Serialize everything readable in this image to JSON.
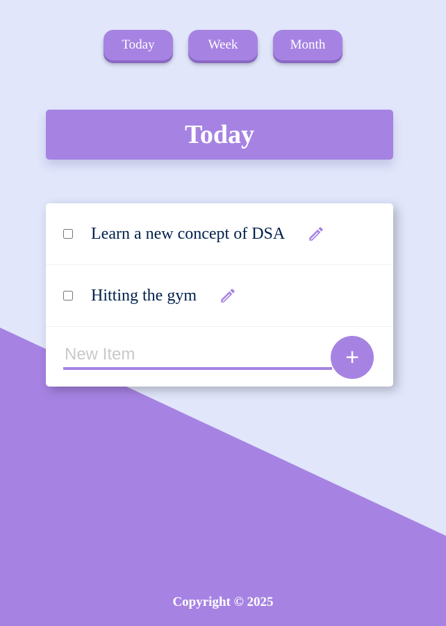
{
  "nav": {
    "buttons": [
      {
        "label": "Today"
      },
      {
        "label": "Week"
      },
      {
        "label": "Month"
      }
    ]
  },
  "list": {
    "title": "Today",
    "items": [
      {
        "text": "Learn a new concept of DSA",
        "checked": false
      },
      {
        "text": "Hitting the gym",
        "checked": false
      }
    ],
    "new_item_placeholder": "New Item",
    "new_item_value": "",
    "add_button_label": "+"
  },
  "footer": {
    "text": "Copyright © 2025"
  },
  "colors": {
    "accent": "#a683e3",
    "background": "#e1e6fb",
    "item_text": "#00204a"
  },
  "icons": {
    "edit": "pencil-icon"
  }
}
